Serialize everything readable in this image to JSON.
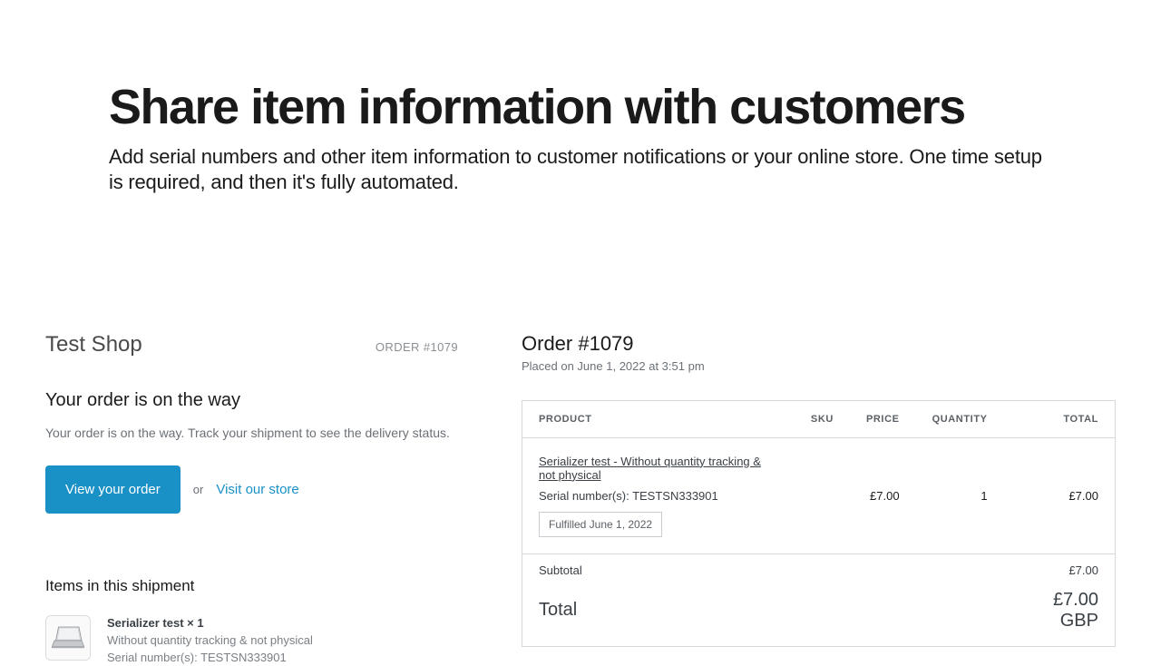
{
  "headline": "Share item information with customers",
  "sub": "Add serial numbers and other item information to customer notifications or your online store. One time setup is required, and then it's fully automated.",
  "email": {
    "shop": "Test Shop",
    "order_label": "ORDER #1079",
    "on_way_title": "Your order is on the way",
    "on_way_desc": "Your order is on the way. Track your shipment to see the delivery status.",
    "view_order_btn": "View your order",
    "or": "or",
    "visit_store": "Visit our store",
    "items_heading": "Items in this shipment",
    "item": {
      "title": "Serializer test × 1",
      "desc": "Without quantity tracking & not physical",
      "serial": "Serial number(s): TESTSN333901"
    }
  },
  "invoice": {
    "title": "Order #1079",
    "placed": "Placed on June 1, 2022 at 3:51 pm",
    "headers": {
      "product": "PRODUCT",
      "sku": "SKU",
      "price": "PRICE",
      "qty": "QUANTITY",
      "total": "TOTAL"
    },
    "row": {
      "name": "Serializer test - Without quantity tracking & not physical",
      "serial": "Serial number(s): TESTSN333901",
      "fulfilled": "Fulfilled June 1, 2022",
      "sku": "",
      "price": "£7.00",
      "qty": "1",
      "total": "£7.00"
    },
    "subtotal": {
      "label": "Subtotal",
      "value": "£7.00"
    },
    "total": {
      "label": "Total",
      "value": "£7.00 GBP"
    }
  }
}
